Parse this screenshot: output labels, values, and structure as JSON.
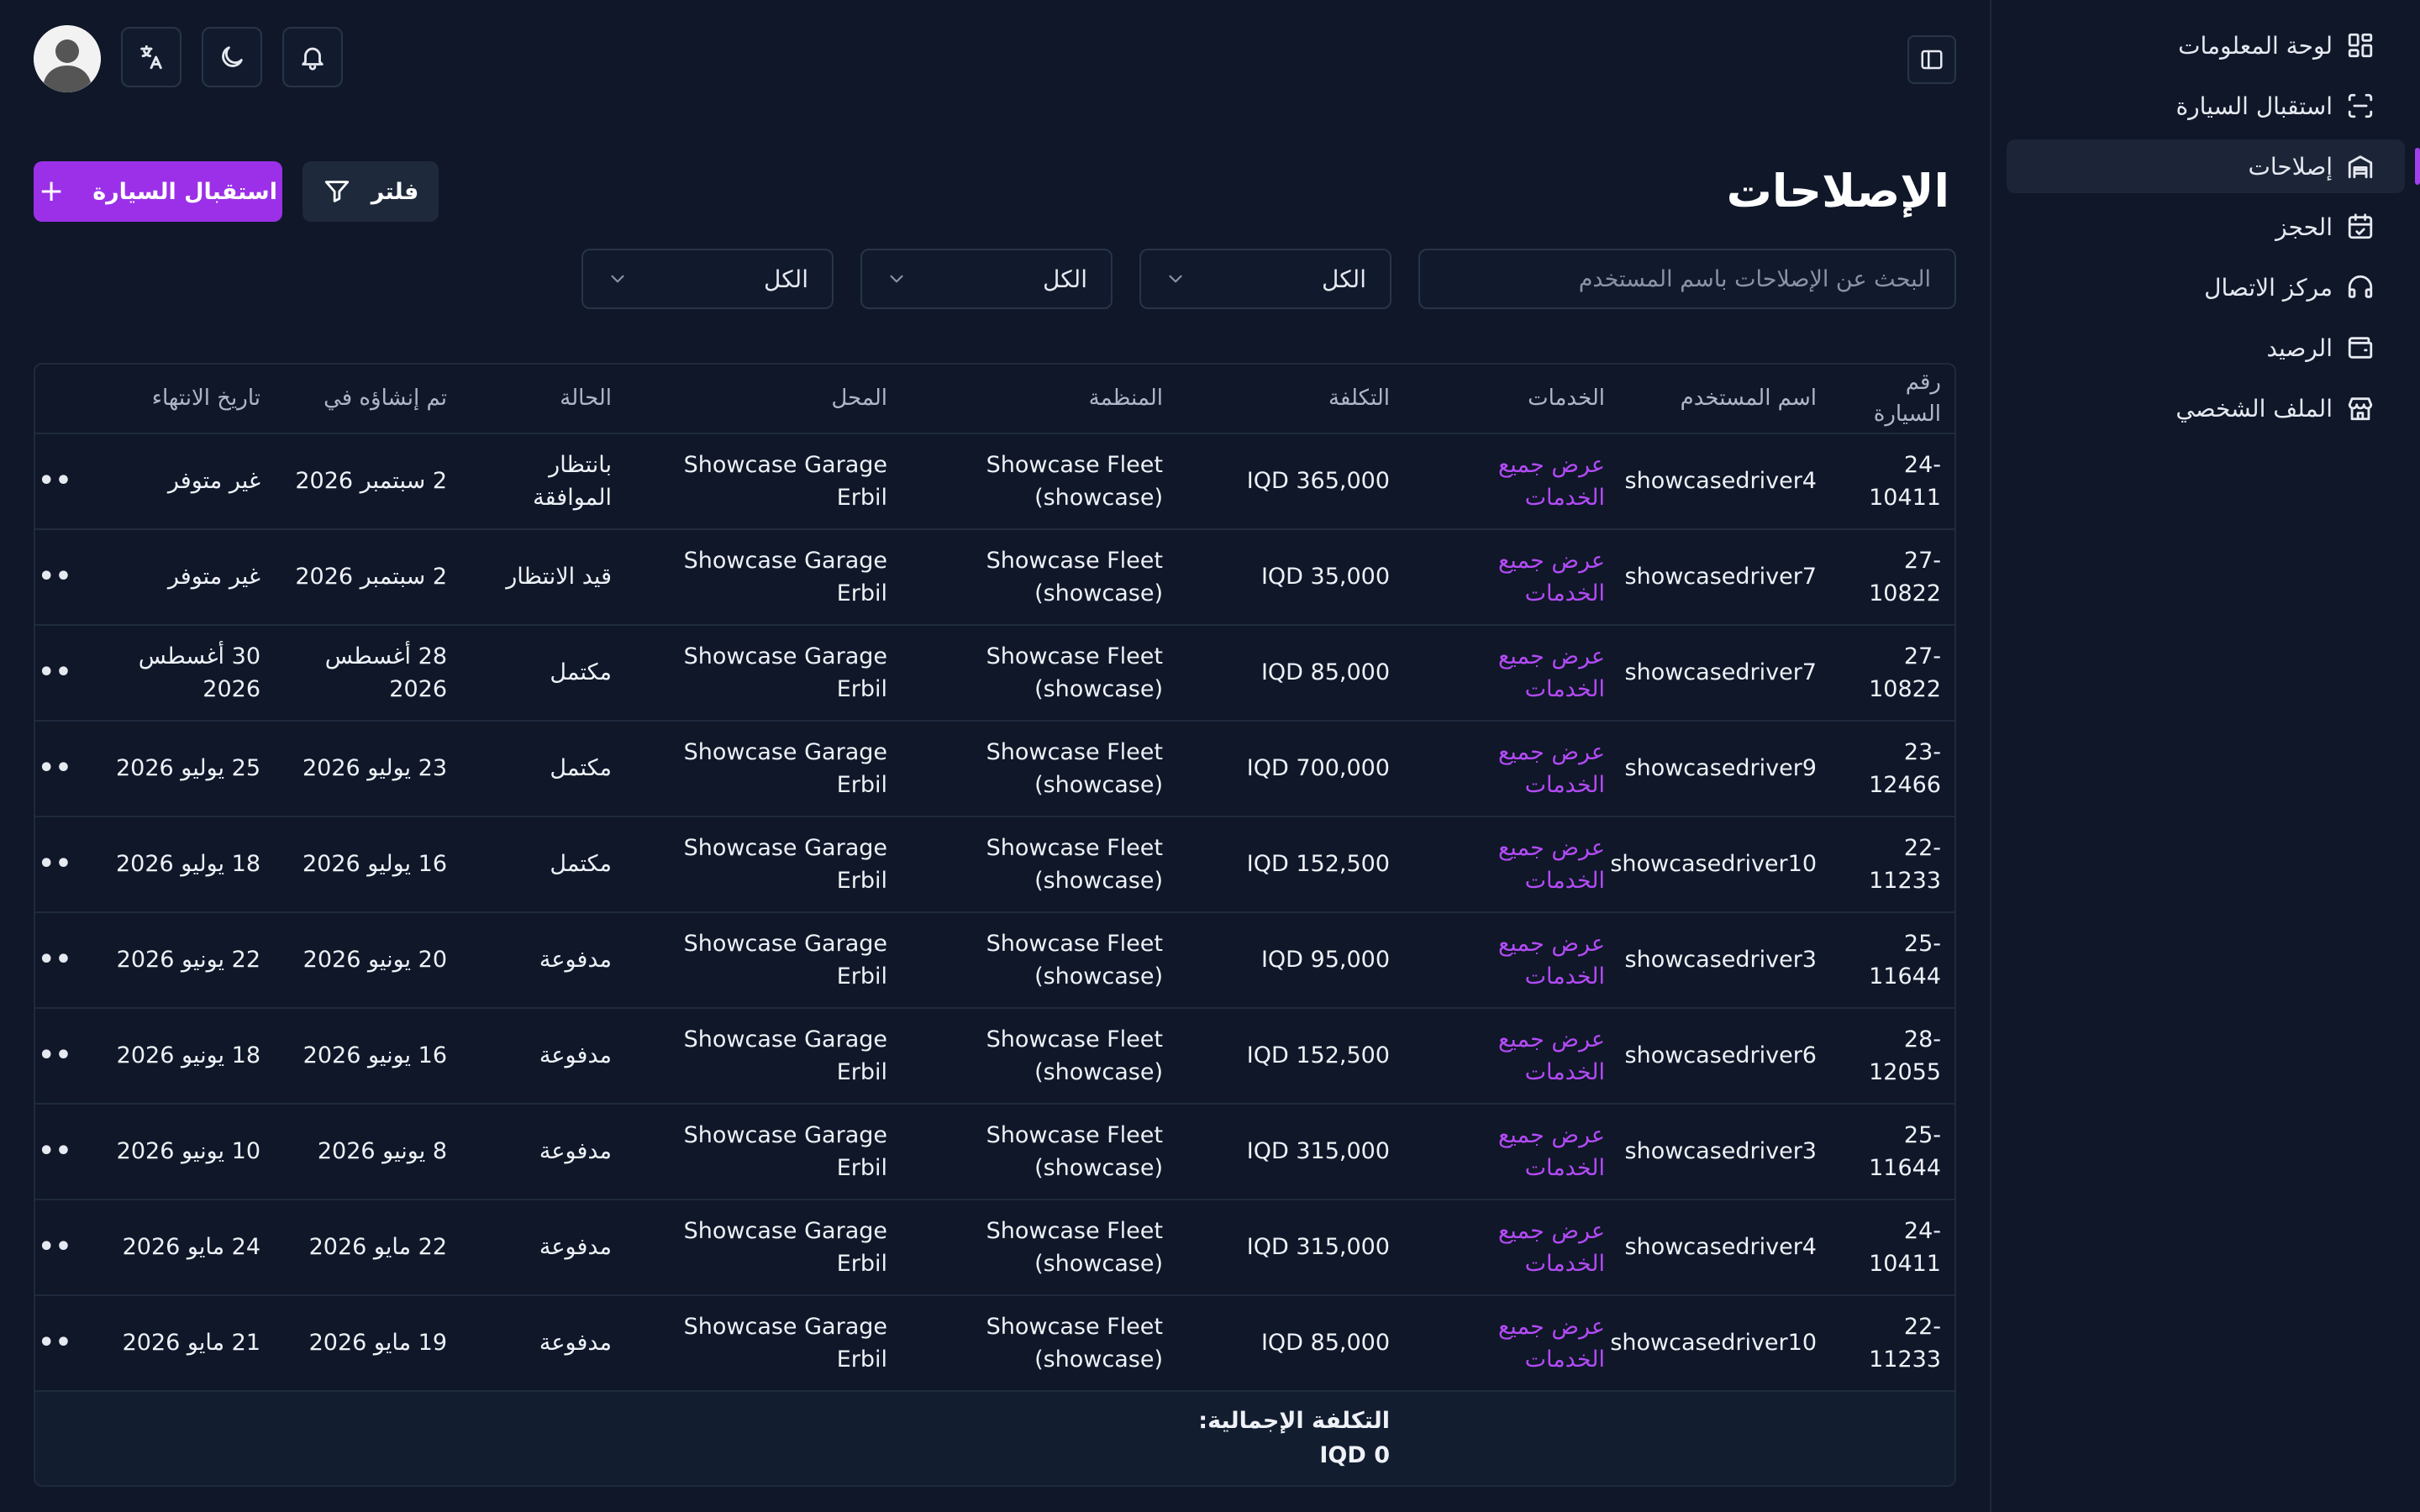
{
  "sidebar": {
    "items": [
      {
        "label": "لوحة المعلومات",
        "icon": "dashboard-icon",
        "active": false
      },
      {
        "label": "استقبال السيارة",
        "icon": "scan-icon",
        "active": false
      },
      {
        "label": "إصلاحات",
        "icon": "garage-icon",
        "active": true
      },
      {
        "label": "الحجز",
        "icon": "calendar-icon",
        "active": false
      },
      {
        "label": "مركز الاتصال",
        "icon": "headset-icon",
        "active": false
      },
      {
        "label": "الرصيد",
        "icon": "wallet-icon",
        "active": false
      },
      {
        "label": "الملف الشخصي",
        "icon": "store-icon",
        "active": false
      }
    ]
  },
  "header": {
    "title": "الإصلاحات",
    "add_button": "استقبال السيارة",
    "filter_button": "فلتر"
  },
  "filters": {
    "search_placeholder": "البحث عن الإصلاحات باسم المستخدم",
    "selects": [
      "الكل",
      "الكل",
      "الكل"
    ]
  },
  "table": {
    "columns": [
      "رقم السيارة",
      "اسم المستخدم",
      "الخدمات",
      "التكلفة",
      "المنظمة",
      "المحل",
      "الحالة",
      "تم إنشاؤه في",
      "تاريخ الانتهاء",
      ""
    ],
    "rows": [
      {
        "car": "24-10411",
        "user": "showcasedriver4",
        "services": "عرض جميع الخدمات",
        "cost": "IQD 365,000",
        "org": "Showcase Fleet (showcase)",
        "shop": "Showcase Garage Erbil",
        "status": "بانتظار الموافقة",
        "created": "2 سبتمبر 2026",
        "end": "غير متوفر"
      },
      {
        "car": "27-10822",
        "user": "showcasedriver7",
        "services": "عرض جميع الخدمات",
        "cost": "IQD 35,000",
        "org": "Showcase Fleet (showcase)",
        "shop": "Showcase Garage Erbil",
        "status": "قيد الانتظار",
        "created": "2 سبتمبر 2026",
        "end": "غير متوفر"
      },
      {
        "car": "27-10822",
        "user": "showcasedriver7",
        "services": "عرض جميع الخدمات",
        "cost": "IQD 85,000",
        "org": "Showcase Fleet (showcase)",
        "shop": "Showcase Garage Erbil",
        "status": "مكتمل",
        "created": "28 أغسطس 2026",
        "end": "30 أغسطس 2026"
      },
      {
        "car": "23-12466",
        "user": "showcasedriver9",
        "services": "عرض جميع الخدمات",
        "cost": "IQD 700,000",
        "org": "Showcase Fleet (showcase)",
        "shop": "Showcase Garage Erbil",
        "status": "مكتمل",
        "created": "23 يوليو 2026",
        "end": "25 يوليو 2026"
      },
      {
        "car": "22-11233",
        "user": "showcasedriver10",
        "services": "عرض جميع الخدمات",
        "cost": "IQD 152,500",
        "org": "Showcase Fleet (showcase)",
        "shop": "Showcase Garage Erbil",
        "status": "مكتمل",
        "created": "16 يوليو 2026",
        "end": "18 يوليو 2026"
      },
      {
        "car": "25-11644",
        "user": "showcasedriver3",
        "services": "عرض جميع الخدمات",
        "cost": "IQD 95,000",
        "org": "Showcase Fleet (showcase)",
        "shop": "Showcase Garage Erbil",
        "status": "مدفوعة",
        "created": "20 يونيو 2026",
        "end": "22 يونيو 2026"
      },
      {
        "car": "28-12055",
        "user": "showcasedriver6",
        "services": "عرض جميع الخدمات",
        "cost": "IQD 152,500",
        "org": "Showcase Fleet (showcase)",
        "shop": "Showcase Garage Erbil",
        "status": "مدفوعة",
        "created": "16 يونيو 2026",
        "end": "18 يونيو 2026"
      },
      {
        "car": "25-11644",
        "user": "showcasedriver3",
        "services": "عرض جميع الخدمات",
        "cost": "IQD 315,000",
        "org": "Showcase Fleet (showcase)",
        "shop": "Showcase Garage Erbil",
        "status": "مدفوعة",
        "created": "8 يونيو 2026",
        "end": "10 يونيو 2026"
      },
      {
        "car": "24-10411",
        "user": "showcasedriver4",
        "services": "عرض جميع الخدمات",
        "cost": "IQD 315,000",
        "org": "Showcase Fleet (showcase)",
        "shop": "Showcase Garage Erbil",
        "status": "مدفوعة",
        "created": "22 مايو 2026",
        "end": "24 مايو 2026"
      },
      {
        "car": "22-11233",
        "user": "showcasedriver10",
        "services": "عرض جميع الخدمات",
        "cost": "IQD 85,000",
        "org": "Showcase Fleet (showcase)",
        "shop": "Showcase Garage Erbil",
        "status": "مدفوعة",
        "created": "19 مايو 2026",
        "end": "21 مايو 2026"
      }
    ],
    "actions_label": "•••",
    "total_label": "التكلفة الإجمالية: 0 IQD"
  }
}
